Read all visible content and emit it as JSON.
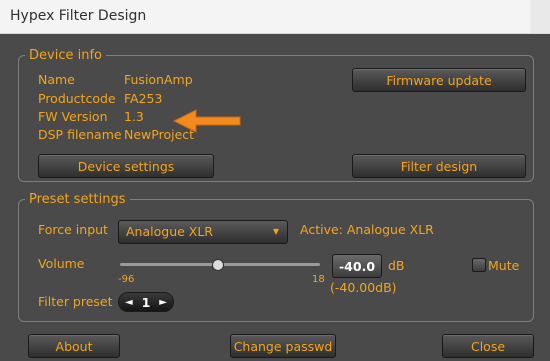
{
  "window": {
    "title": "Hypex Filter Design"
  },
  "device_info": {
    "legend": "Device info",
    "name_label": "Name",
    "name_value": "FusionAmp",
    "productcode_label": "Productcode",
    "productcode_value": "FA253",
    "fw_label": "FW Version",
    "fw_value": "1.3",
    "dsp_label": "DSP filename",
    "dsp_value": "NewProject",
    "firmware_update_label": "Firmware update",
    "device_settings_label": "Device settings",
    "filter_design_label": "Filter design"
  },
  "preset": {
    "legend": "Preset settings",
    "force_input_label": "Force input",
    "force_input_value": "Analogue XLR",
    "active_label": "Active: Analogue XLR",
    "volume_label": "Volume",
    "volume_min": "-96",
    "volume_max": "18",
    "volume_value": "-40.0",
    "volume_unit": "dB",
    "volume_actual": "(-40.00dB)",
    "volume_level_fraction": 0.49,
    "mute_label": "Mute",
    "filter_preset_label": "Filter preset",
    "filter_preset_value": "1",
    "prev_glyph": "◄",
    "next_glyph": "►"
  },
  "footer": {
    "about_label": "About",
    "change_passwd_label": "Change passwd",
    "close_label": "Close"
  },
  "colors": {
    "accent": "#f4a51a",
    "annotation_arrow": "#f28a1d",
    "background": "#4a4a4a"
  },
  "icons": {
    "dropdown": "chevron-down-icon",
    "annotation": "arrow-left-icon"
  }
}
